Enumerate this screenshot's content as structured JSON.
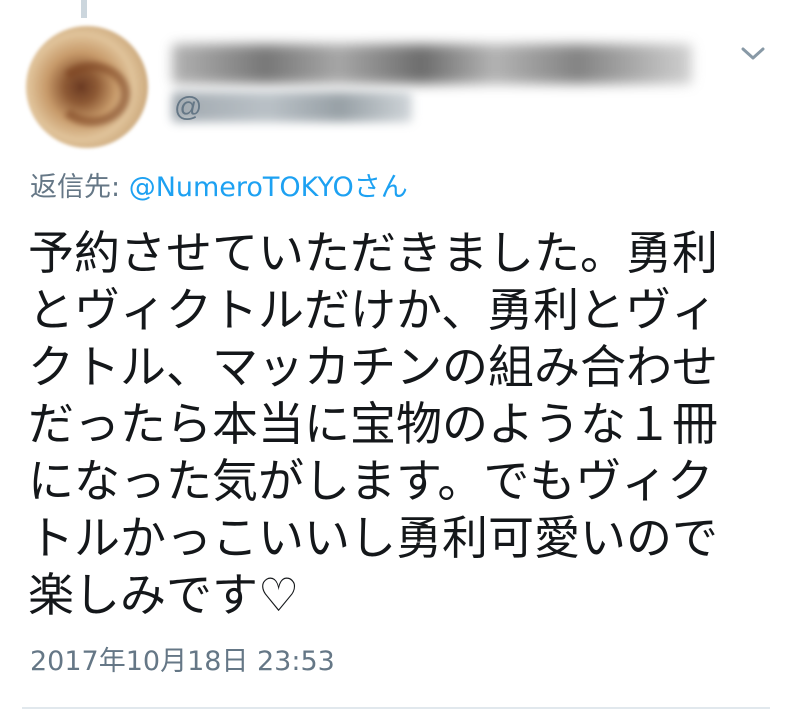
{
  "tweet": {
    "author": {
      "display_name": "",
      "handle_prefix": "@"
    },
    "reply_to": {
      "label": "返信先: ",
      "mention": "@NumeroTOKYOさん"
    },
    "text_lines": [
      "予約させていただきました。勇利",
      "とヴィクトルだけか、勇利とヴィ",
      "クトル、マッカチンの組み合わせ",
      "だったら本当に宝物のような１冊",
      "になった気がします。でもヴィク",
      "トルかっこいいし勇利可愛いので",
      "楽しみです♡"
    ],
    "timestamp": "2017年10月18日 23:53",
    "icons": {
      "menu": "chevron-down-icon"
    },
    "colors": {
      "text": "#14171a",
      "secondary": "#657786",
      "link": "#1da1f2",
      "divider": "#e1e8ed"
    }
  }
}
